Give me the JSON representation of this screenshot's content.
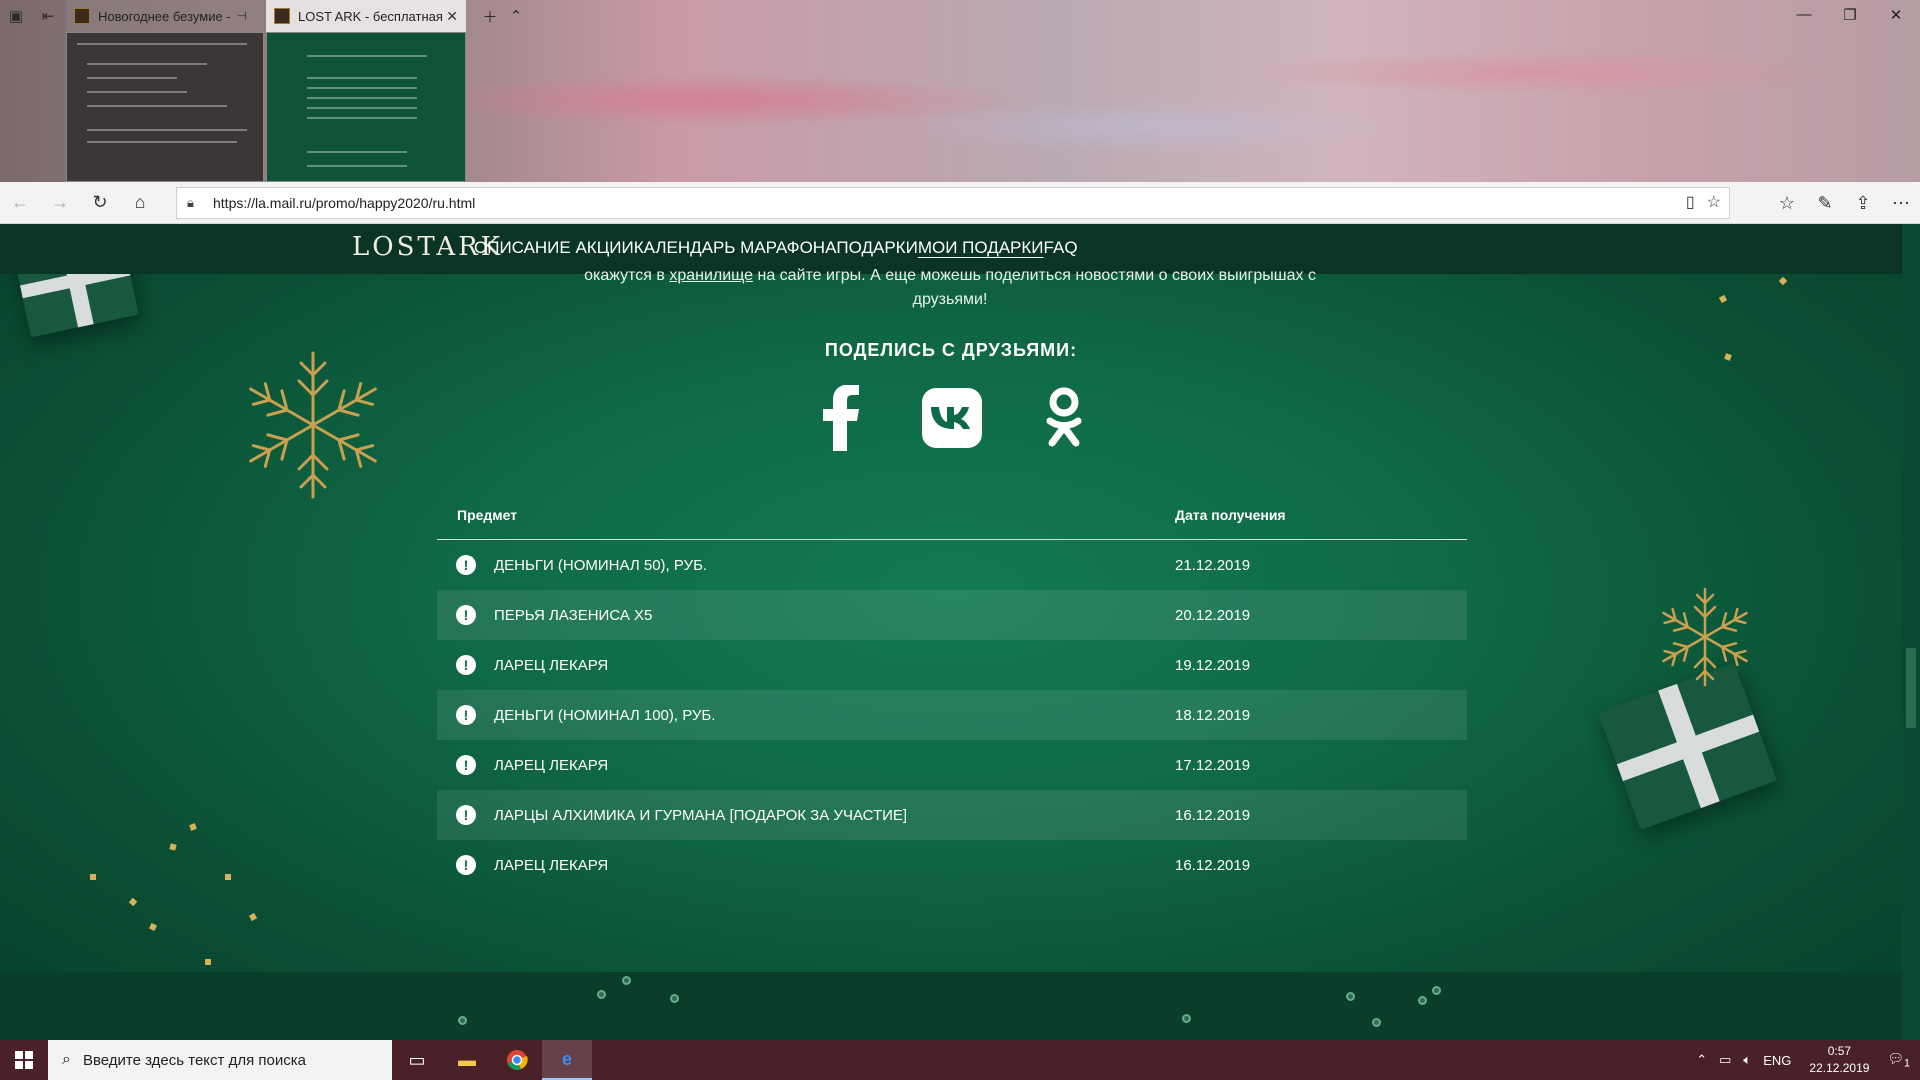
{
  "tabs": [
    {
      "title": "Новогоднее безумие -",
      "active": false
    },
    {
      "title": "LOST ARK - бесплатная",
      "active": true
    }
  ],
  "address_bar": {
    "url": "https://la.mail.ru/promo/happy2020/ru.html"
  },
  "site": {
    "logo": "LOSTARK",
    "menu": [
      {
        "label": "ОПИСАНИЕ АКЦИИ"
      },
      {
        "label": "КАЛЕНДАРЬ МАРАФОНА"
      },
      {
        "label": "ПОДАРКИ"
      },
      {
        "label": "МОИ ПОДАРКИ",
        "current": true
      },
      {
        "label": "FAQ"
      }
    ],
    "intro_prefix": "окажутся в",
    "intro_link": "хранилище",
    "intro_suffix": "на сайте игры. А еще можешь поделиться новостями о своих выигрышах с друзьями!",
    "share_title": "ПОДЕЛИСЬ С ДРУЗЬЯМИ:",
    "social": [
      "facebook-icon",
      "vk-icon",
      "odnoklassniki-icon"
    ]
  },
  "gifts_table": {
    "col_item": "Предмет",
    "col_date": "Дата получения",
    "rows": [
      {
        "item": "ДЕНЬГИ (НОМИНАЛ 50), РУБ.",
        "date": "21.12.2019"
      },
      {
        "item": "ПЕРЬЯ ЛАЗЕНИСА X5",
        "date": "20.12.2019"
      },
      {
        "item": "ЛАРЕЦ ЛЕКАРЯ",
        "date": "19.12.2019"
      },
      {
        "item": "ДЕНЬГИ (НОМИНАЛ 100), РУБ.",
        "date": "18.12.2019"
      },
      {
        "item": "ЛАРЕЦ ЛЕКАРЯ",
        "date": "17.12.2019"
      },
      {
        "item": "ЛАРЦЫ АЛХИМИКА И ГУРМАНА [ПОДАРОК ЗА УЧАСТИЕ]",
        "date": "16.12.2019"
      },
      {
        "item": "ЛАРЕЦ ЛЕКАРЯ",
        "date": "16.12.2019"
      }
    ]
  },
  "taskbar": {
    "search_placeholder": "Введите здесь текст для поиска",
    "language": "ENG",
    "time": "0:57",
    "date": "22.12.2019",
    "notification_count": "1"
  },
  "colors": {
    "page_green": "#0f6a47",
    "nav_dark": "#0a3526",
    "gold": "#d8b25a",
    "taskbar": "#4a2028"
  }
}
